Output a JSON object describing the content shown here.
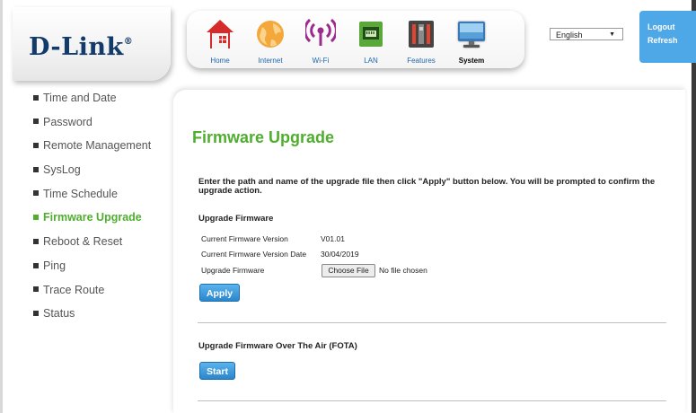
{
  "header": {
    "logo": "D-Link",
    "logo_mark": "®",
    "nav": [
      {
        "label": "Home",
        "icon": "home-icon"
      },
      {
        "label": "Internet",
        "icon": "globe-icon"
      },
      {
        "label": "Wi-Fi",
        "icon": "wifi-icon"
      },
      {
        "label": "LAN",
        "icon": "lan-port-icon"
      },
      {
        "label": "Features",
        "icon": "features-icon"
      },
      {
        "label": "System",
        "icon": "monitor-icon"
      }
    ],
    "active_nav": "System",
    "language": "English",
    "logout": "Logout",
    "refresh": "Refresh"
  },
  "sidebar": {
    "items": [
      {
        "label": "Time and Date"
      },
      {
        "label": "Password"
      },
      {
        "label": "Remote Management"
      },
      {
        "label": "SysLog"
      },
      {
        "label": "Time Schedule"
      },
      {
        "label": "Firmware Upgrade"
      },
      {
        "label": "Reboot & Reset"
      },
      {
        "label": "Ping"
      },
      {
        "label": "Trace Route"
      },
      {
        "label": "Status"
      }
    ],
    "active": "Firmware Upgrade"
  },
  "main": {
    "title": "Firmware Upgrade",
    "description": "Enter the path and name of the upgrade file then click \"Apply\" button below. You will be prompted to confirm the upgrade action.",
    "upgrade_section": {
      "title": "Upgrade Firmware",
      "current_version_label": "Current Firmware Version",
      "current_version_value": "V01.01",
      "current_date_label": "Current Firmware Version Date",
      "current_date_value": "30/04/2019",
      "upgrade_label": "Upgrade Firmware",
      "choose_file": "Choose File",
      "no_file": "No file chosen",
      "apply": "Apply"
    },
    "fota_section": {
      "title": "Upgrade Firmware Over The Air (FOTA)",
      "start": "Start"
    }
  },
  "colors": {
    "accent_green": "#4fae2e",
    "button_blue": "#2b86cc",
    "logout_blue": "#4ea7e6",
    "logo_navy": "#123a6b"
  }
}
